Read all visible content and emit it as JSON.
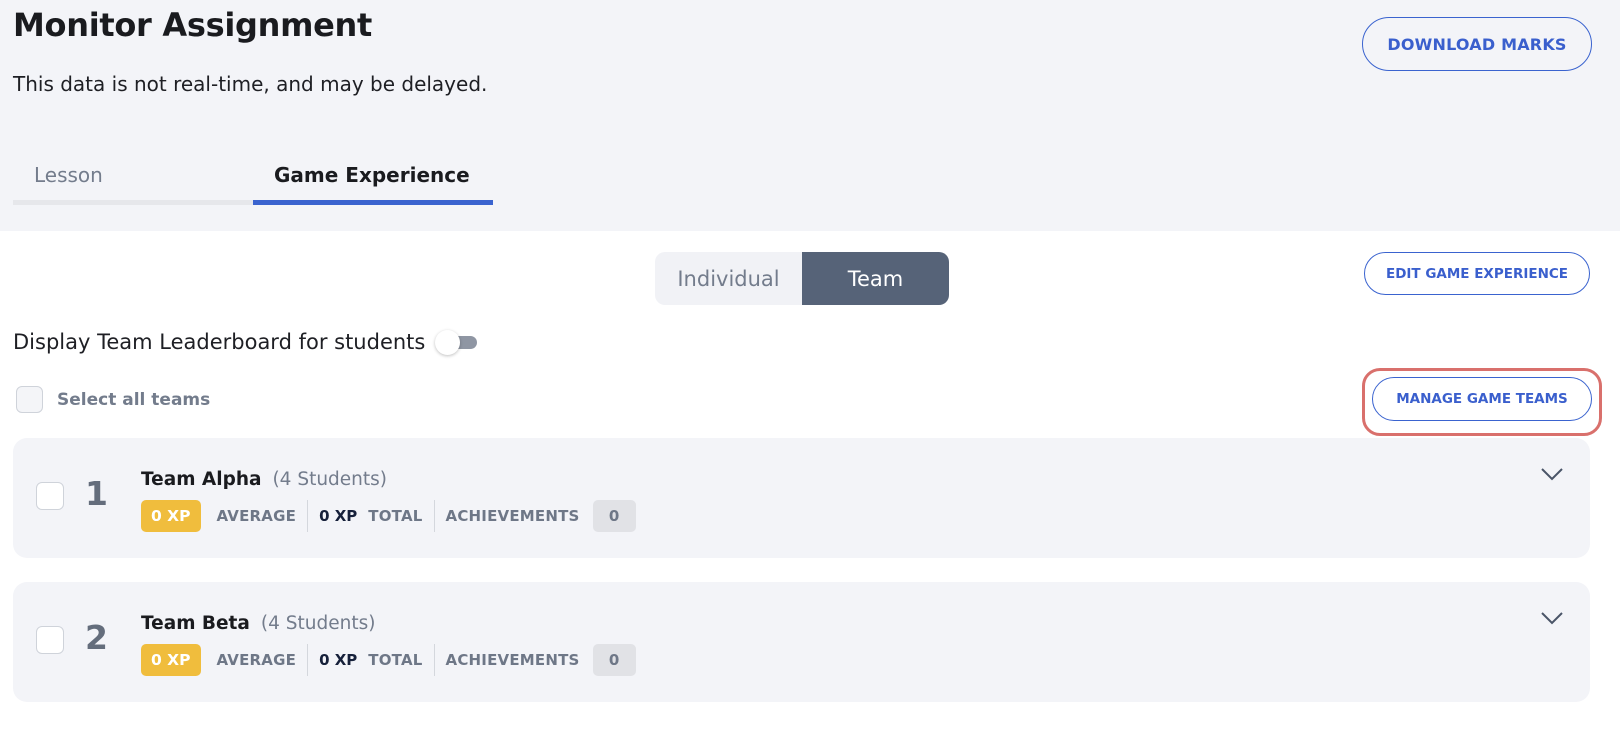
{
  "header": {
    "title": "Monitor Assignment",
    "subtitle": "This data is not real-time, and may be delayed.",
    "download_button": "DOWNLOAD MARKS"
  },
  "tabs": [
    {
      "label": "Lesson",
      "active": false
    },
    {
      "label": "Game Experience",
      "active": true
    }
  ],
  "view_toggle": {
    "options": [
      "Individual",
      "Team"
    ],
    "selected": "Team"
  },
  "edit_button": "EDIT GAME EXPERIENCE",
  "leaderboard": {
    "label": "Display Team Leaderboard for students",
    "enabled": false
  },
  "select_all": {
    "label": "Select all teams",
    "checked": false
  },
  "manage_button": "MANAGE GAME TEAMS",
  "colors": {
    "accent": "#3a63cf",
    "xp_badge": "#f0bd3d",
    "highlight": "#d9706c",
    "segment_active": "#566378"
  },
  "teams": [
    {
      "rank": "1",
      "name": "Team Alpha",
      "students": "(4 Students)",
      "average_xp": "0 XP",
      "average_label": "AVERAGE",
      "total_xp": "0 XP",
      "total_label": "TOTAL",
      "achievements_label": "ACHIEVEMENTS",
      "achievements": "0",
      "icon": "chevron-down-icon"
    },
    {
      "rank": "2",
      "name": "Team Beta",
      "students": "(4 Students)",
      "average_xp": "0 XP",
      "average_label": "AVERAGE",
      "total_xp": "0 XP",
      "total_label": "TOTAL",
      "achievements_label": "ACHIEVEMENTS",
      "achievements": "0",
      "icon": "chevron-down-icon"
    }
  ]
}
